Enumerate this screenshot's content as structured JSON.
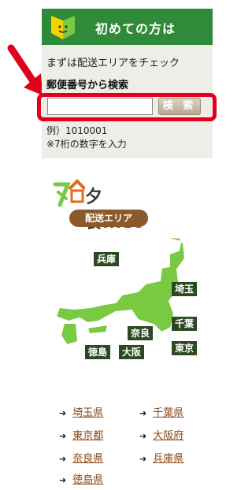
{
  "header": {
    "title": "初めての方は",
    "badge_icon": "beginner-mark-icon"
  },
  "intro_text": "まずは配送エリアをチェック",
  "zip_search": {
    "label": "郵便番号から検索",
    "input_value": "",
    "button_label": "検 索",
    "example": "例）1010001",
    "note": "※7桁の数字を入力"
  },
  "logo": {
    "brand": "夕食.net",
    "pill": "配送エリア"
  },
  "map": {
    "tags": [
      "兵庫",
      "埼玉",
      "千葉",
      "東京",
      "奈良",
      "大阪",
      "徳島"
    ]
  },
  "prefecture_links": [
    "埼玉県",
    "千葉県",
    "東京都",
    "大阪府",
    "奈良県",
    "兵庫県",
    "徳島県"
  ],
  "colors": {
    "header_green": "#2f8a3a",
    "highlight_red": "#e0001b",
    "link_brown": "#8b4513",
    "map_green": "#7ac943"
  }
}
